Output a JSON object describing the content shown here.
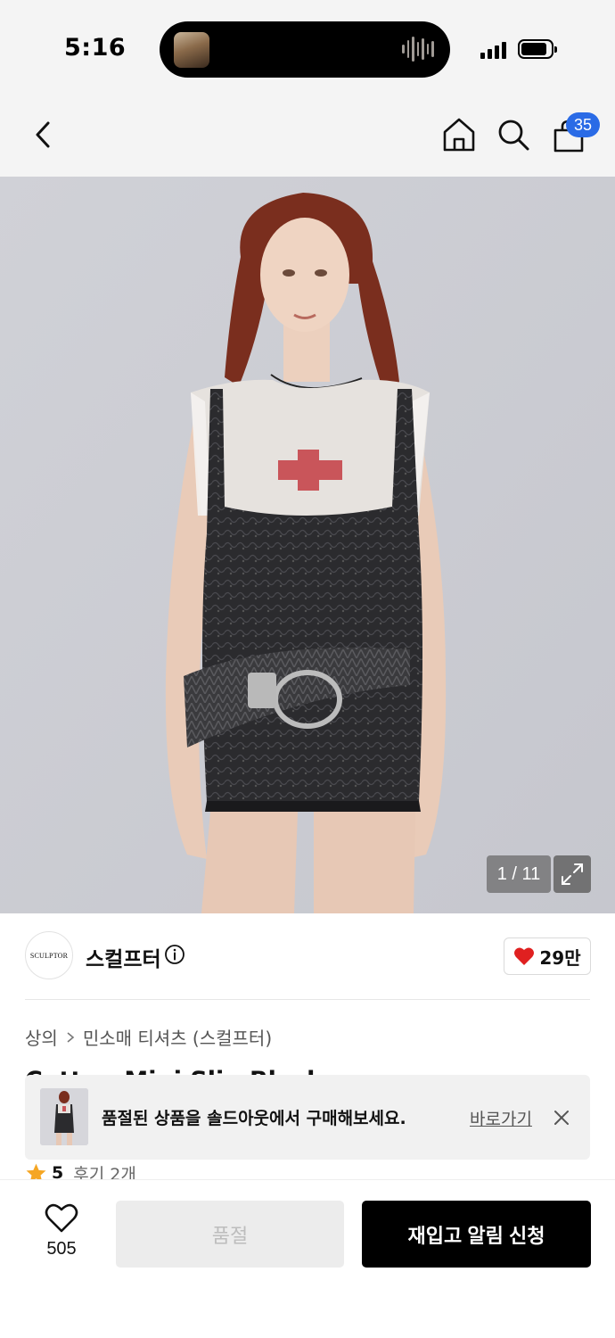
{
  "status_bar": {
    "time": "5:16"
  },
  "header": {
    "cart_badge": "35",
    "icons": [
      "back-icon",
      "home-icon",
      "search-icon",
      "cart-icon"
    ]
  },
  "gallery": {
    "counter": "1 / 11",
    "current_image": 1,
    "total_images": 11
  },
  "brand": {
    "logo_text": "SCULPTOR",
    "name": "스컬프터",
    "like_count": "29만",
    "heart_color": "#e02020"
  },
  "breadcrumb": {
    "items": [
      "상의",
      "민소매 티셔츠 (스컬프터)"
    ]
  },
  "product": {
    "title_partial": "Cotton Mini Slip Black"
  },
  "banner": {
    "text": "품절된 상품을 솔드아웃에서 구매해보세요.",
    "link_label": "바로가기"
  },
  "rating": {
    "score": "5",
    "reviews": "후기 2개",
    "star_color": "#f5a623"
  },
  "bottom_bar": {
    "wishlist_count": "505",
    "soldout_label": "품절",
    "restock_label": "재입고 알림 신청"
  }
}
